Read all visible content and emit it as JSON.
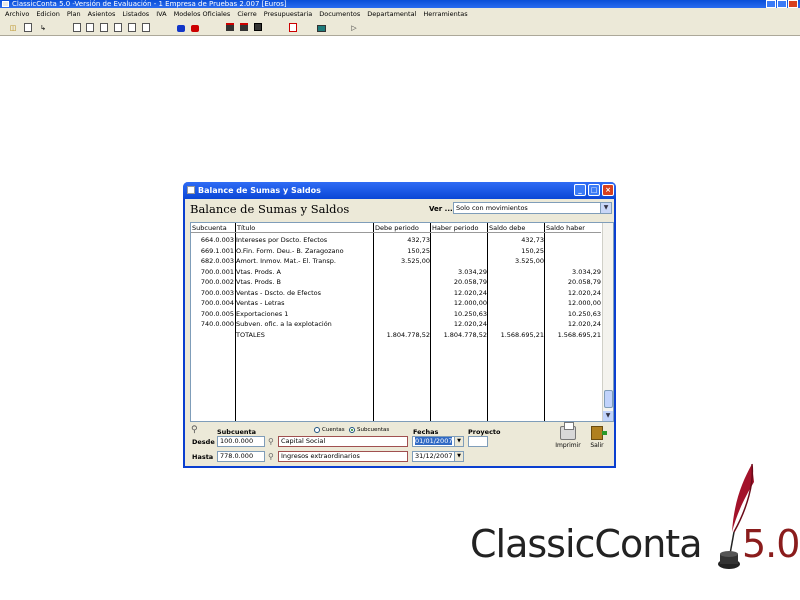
{
  "app": {
    "title": "ClassicConta 5.0 -Versión de Evaluación -      1 Empresa de Pruebas 2.007 [Euros]"
  },
  "menu": [
    "Archivo",
    "Edicion",
    "Plan",
    "Asientos",
    "Listados",
    "IVA",
    "Modelos Oficiales",
    "Cierre",
    "Presupuestaria",
    "Documentos",
    "Departamental",
    "Herramientas"
  ],
  "toolbar": {
    "icons": [
      "open-folder-icon",
      "document-icon",
      "tree-icon",
      "doc-b-icon",
      "doc-icon",
      "doc-lines-icon",
      "doc-k-icon",
      "doc-m-icon",
      "doc-e-icon",
      "blue-car-icon",
      "red-car-icon",
      "save-red-icon",
      "save-red2-icon",
      "save-icon",
      "pdf-icon",
      "screen-icon",
      "exit-icon"
    ]
  },
  "dialog": {
    "title": "Balance de Sumas y Saldos",
    "heading": "Balance de Sumas y Saldos",
    "ver_label": "Ver ...",
    "ver_value": "Solo con movimientos",
    "columns": {
      "subcuenta": "Subcuenta",
      "titulo": "Título",
      "debe": "Debe periodo",
      "haber": "Haber periodo",
      "saldo_debe": "Saldo debe",
      "saldo_haber": "Saldo haber"
    },
    "rows": [
      {
        "sub": "664.0.003",
        "tit": "Intereses por Dscto. Efectos",
        "debe": "432,73",
        "haber": "",
        "sdebe": "432,73",
        "shaber": ""
      },
      {
        "sub": "669.1.001",
        "tit": "O.Fin. Form. Deu.- B. Zaragozano",
        "debe": "150,25",
        "haber": "",
        "sdebe": "150,25",
        "shaber": ""
      },
      {
        "sub": "682.0.003",
        "tit": "Amort. Inmov. Mat.- El. Transp.",
        "debe": "3.525,00",
        "haber": "",
        "sdebe": "3.525,00",
        "shaber": ""
      },
      {
        "sub": "700.0.001",
        "tit": "Vtas. Prods. A",
        "debe": "",
        "haber": "3.034,29",
        "sdebe": "",
        "shaber": "3.034,29"
      },
      {
        "sub": "700.0.002",
        "tit": "Vtas. Prods. B",
        "debe": "",
        "haber": "20.058,79",
        "sdebe": "",
        "shaber": "20.058,79"
      },
      {
        "sub": "700.0.003",
        "tit": "Ventas - Dscto. de Efectos",
        "debe": "",
        "haber": "12.020,24",
        "sdebe": "",
        "shaber": "12.020,24"
      },
      {
        "sub": "700.0.004",
        "tit": "Ventas - Letras",
        "debe": "",
        "haber": "12.000,00",
        "sdebe": "",
        "shaber": "12.000,00"
      },
      {
        "sub": "700.0.005",
        "tit": "Exportaciones 1",
        "debe": "",
        "haber": "10.250,63",
        "sdebe": "",
        "shaber": "10.250,63"
      },
      {
        "sub": "740.0.000",
        "tit": "Subven. ofic. a la explotación",
        "debe": "",
        "haber": "12.020,24",
        "sdebe": "",
        "shaber": "12.020,24"
      },
      {
        "sub": "",
        "tit": "TOTALES",
        "debe": "1.804.778,52",
        "haber": "1.804.778,52",
        "sdebe": "1.568.695,21",
        "shaber": "1.568.695,21"
      }
    ],
    "filter": {
      "subcuenta_label": "Subcuenta",
      "radio_cuentas": "Cuentas",
      "radio_subcuentas": "Subcuentas",
      "fechas_label": "Fechas",
      "proyecto_label": "Proyecto",
      "desde_label": "Desde",
      "hasta_label": "Hasta",
      "desde_code": "100.0.000",
      "desde_name": "Capital Social",
      "desde_date": "01/01/2007",
      "hasta_code": "778.0.000",
      "hasta_name": "Ingresos extraordinarios",
      "hasta_date": "31/12/2007",
      "proyecto_value": ""
    },
    "buttons": {
      "print_label": "Imprimir",
      "exit_label": "Salir"
    }
  },
  "logo": {
    "brand": "ClassicConta",
    "version": "5.0"
  }
}
